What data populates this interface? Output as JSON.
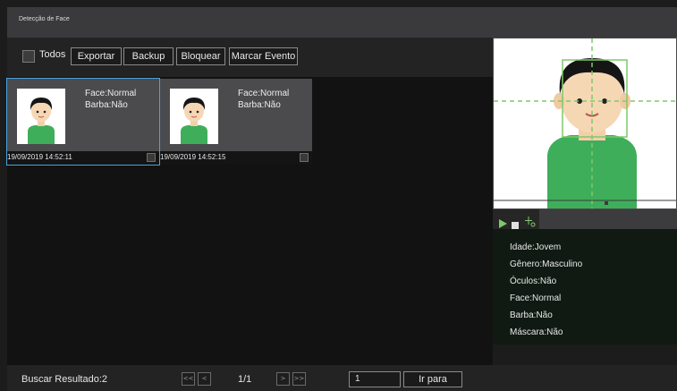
{
  "window": {
    "title": "Detecção de Face"
  },
  "toolbar": {
    "select_all_label": "Todos",
    "buttons": [
      "Exportar",
      "Backup",
      "Bloquear",
      "Marcar Evento"
    ]
  },
  "results": [
    {
      "face": "Face:Normal",
      "beard": "Barba:Não",
      "timestamp": "19/09/2019 14:52:11",
      "selected": true
    },
    {
      "face": "Face:Normal",
      "beard": "Barba:Não",
      "timestamp": "19/09/2019 14:52:15",
      "selected": false
    }
  ],
  "preview": {
    "controls": [
      "play-icon",
      "stop-icon",
      "crosshair-icon"
    ],
    "attributes": [
      "Idade:Jovem",
      "Gênero:Masculino",
      "Óculos:Não",
      "Face:Normal",
      "Barba:Não",
      "Máscara:Não"
    ]
  },
  "footer": {
    "result_count": "Buscar Resultado:2",
    "nav": {
      "first": "<<",
      "prev": "<",
      "next": ">",
      "last": ">>"
    },
    "page_indicator": "1/1",
    "goto_value": "1",
    "goto_label": "Ir para"
  },
  "colors": {
    "accent_green": "#7fc96a",
    "selection_blue": "#4aa3df",
    "shirt_green": "#3fae5a"
  }
}
